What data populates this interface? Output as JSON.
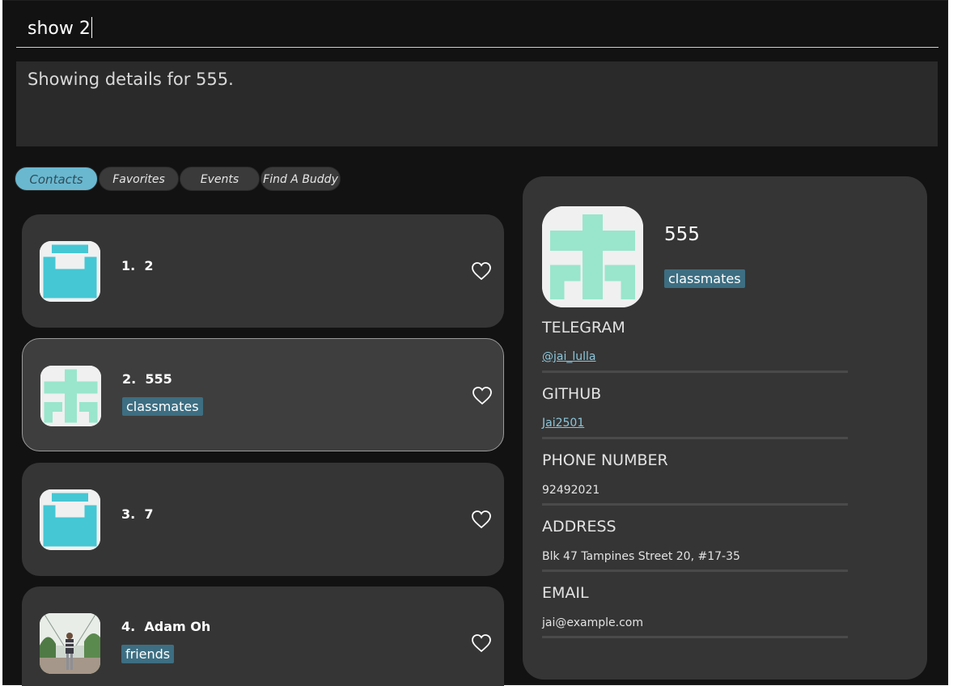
{
  "command": {
    "value": "show 2"
  },
  "result": {
    "text": "Showing details for 555."
  },
  "tabs": [
    "Contacts",
    "Favorites",
    "Events",
    "Find A Buddy"
  ],
  "contacts": [
    {
      "index": "1.",
      "name": "2",
      "tag": "",
      "avatar": "cyan-identicon",
      "favorite": false
    },
    {
      "index": "2.",
      "name": "555",
      "tag": "classmates",
      "avatar": "mint-identicon",
      "favorite": false
    },
    {
      "index": "3.",
      "name": "7",
      "tag": "",
      "avatar": "cyan-identicon",
      "favorite": false
    },
    {
      "index": "4.",
      "name": "Adam Oh",
      "tag": "friends",
      "avatar": "photo",
      "favorite": false
    }
  ],
  "detail": {
    "name": "555",
    "tag": "classmates",
    "telegram_label": "TELEGRAM",
    "telegram": "@jai_lulla",
    "github_label": "GITHUB",
    "github": "Jai2501",
    "phone_label": "PHONE NUMBER",
    "phone": "92492021",
    "address_label": "ADDRESS",
    "address": "Blk 47 Tampines Street 20, #17-35",
    "email_label": "EMAIL",
    "email": "jai@example.com"
  },
  "colors": {
    "background": "#121212",
    "card": "#353535",
    "active_tab": "#6ab8d0",
    "tag": "#3d6e82",
    "identicon_cyan": "#45c7d4",
    "identicon_mint": "#99e6cc"
  },
  "icons": [
    "heart-icon"
  ]
}
